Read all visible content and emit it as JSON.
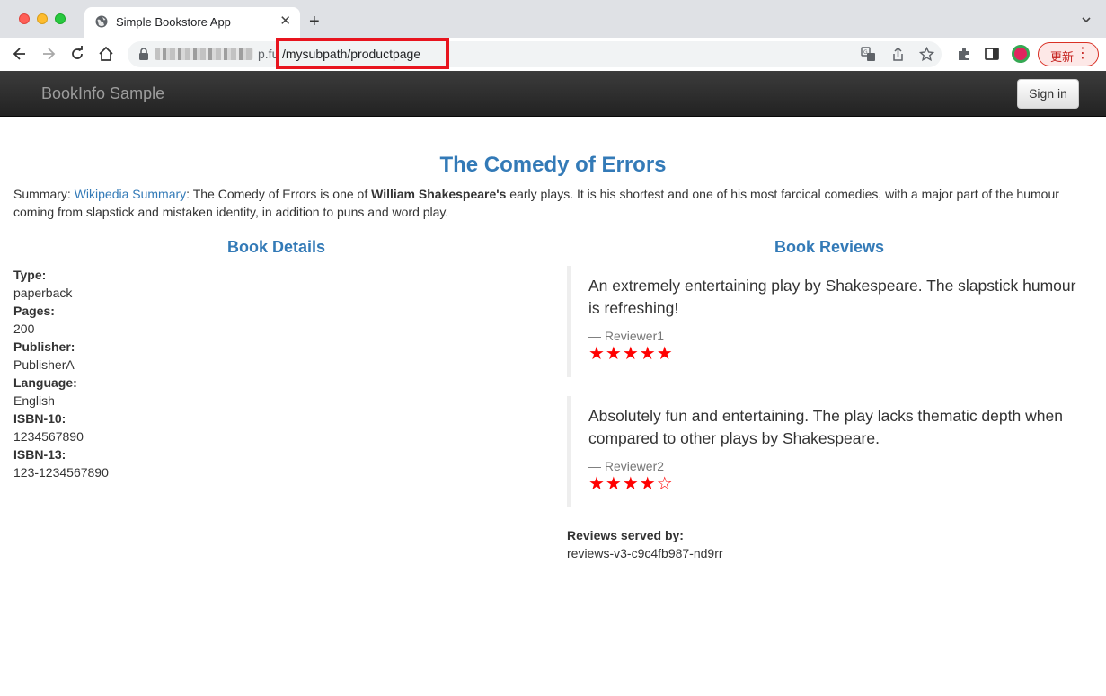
{
  "browser": {
    "tab_title": "Simple Bookstore App",
    "new_tab_symbol": "+",
    "close_symbol": "✕",
    "url_host_tail": "p.fu",
    "url_path": "/mysubpath/productpage",
    "update_label": "更新",
    "menu_symbol": "⋮",
    "highlight_color": "#e8141e"
  },
  "navbar": {
    "brand": "BookInfo Sample",
    "signin_label": "Sign in"
  },
  "book": {
    "title": "The Comedy of Errors",
    "summary_label": "Summary: ",
    "summary_link": "Wikipedia Summary",
    "summary_pre": ": The Comedy of Errors is one of ",
    "summary_bold": "William Shakespeare's",
    "summary_post": " early plays. It is his shortest and one of his most farcical comedies, with a major part of the humour coming from slapstick and mistaken identity, in addition to puns and word play."
  },
  "details": {
    "heading": "Book Details",
    "fields": [
      {
        "label": "Type:",
        "value": "paperback"
      },
      {
        "label": "Pages:",
        "value": "200"
      },
      {
        "label": "Publisher:",
        "value": "PublisherA"
      },
      {
        "label": "Language:",
        "value": "English"
      },
      {
        "label": "ISBN-10:",
        "value": "1234567890"
      },
      {
        "label": "ISBN-13:",
        "value": "123-1234567890"
      }
    ]
  },
  "reviews": {
    "heading": "Book Reviews",
    "items": [
      {
        "text": "An extremely entertaining play by Shakespeare. The slapstick humour is refreshing!",
        "reviewer": "— Reviewer1",
        "stars": "★★★★★",
        "rating": 5,
        "star_color": "#ff0000"
      },
      {
        "text": "Absolutely fun and entertaining. The play lacks thematic depth when compared to other plays by Shakespeare.",
        "reviewer": "— Reviewer2",
        "stars": "★★★★☆",
        "rating": 4,
        "star_color": "#ff0000"
      }
    ],
    "served_label": "Reviews served by:",
    "served_value": "reviews-v3-c9c4fb987-nd9rr"
  },
  "icons": {
    "tab_favicon": "globe-icon",
    "back": "back-arrow-icon",
    "forward": "forward-arrow-icon",
    "reload": "reload-icon",
    "home": "home-icon",
    "lock": "lock-icon",
    "translate": "translate-icon",
    "share": "share-icon",
    "bookmark": "star-icon",
    "extensions": "puzzle-icon",
    "side_panel": "side-panel-icon"
  }
}
